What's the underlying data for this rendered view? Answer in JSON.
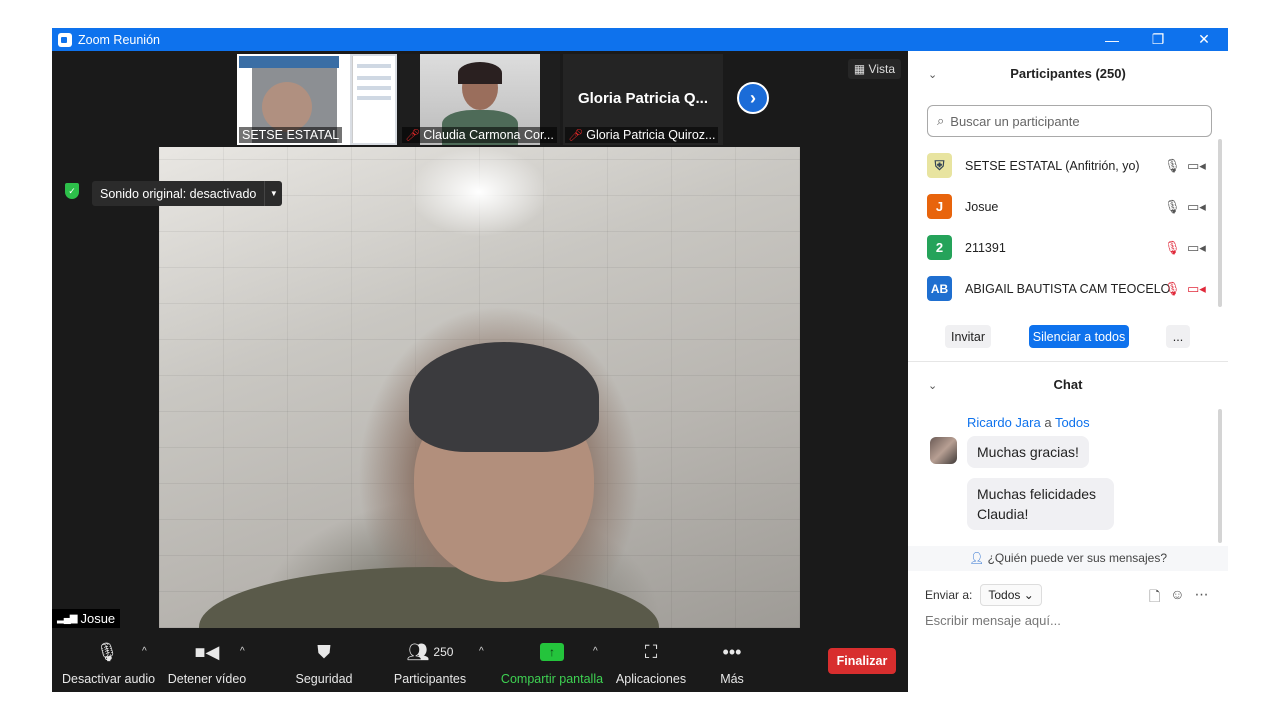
{
  "window": {
    "title": "Zoom Reunión",
    "controls": [
      "—",
      "❐",
      "✕"
    ]
  },
  "stage": {
    "view_label": "Vista",
    "thumbnails": [
      {
        "name": "SETSE ESTATAL",
        "muted": false
      },
      {
        "name": "Claudia Carmona Cor...",
        "muted": true
      },
      {
        "name": "Gloria Patricia Quiroz...",
        "muted": true,
        "big_name": "Gloria Patricia Q..."
      }
    ],
    "next_icon": "›",
    "sound_original": "Sonido original: desactivado",
    "active_speaker": "Josue"
  },
  "toolbar": {
    "audio": "Desactivar audio",
    "video": "Detener vídeo",
    "security": "Seguridad",
    "participants": "Participantes",
    "participants_count": "250",
    "share": "Compartir pantalla",
    "apps": "Aplicaciones",
    "more": "Más",
    "end": "Finalizar"
  },
  "participants_panel": {
    "title": "Participantes (250)",
    "search_placeholder": "Buscar un participante",
    "list": [
      {
        "initials": "",
        "name": "SETSE ESTATAL (Anfitrión, yo)",
        "color": "#e8e4a0",
        "mic_muted": false,
        "cam_off": false
      },
      {
        "initials": "J",
        "name": "Josue",
        "color": "#e8640c",
        "mic_muted": false,
        "cam_off": false
      },
      {
        "initials": "2",
        "name": "211391",
        "color": "#25a35a",
        "mic_muted": true,
        "cam_off": false
      },
      {
        "initials": "AB",
        "name": "ABIGAIL BAUTISTA CAM TEOCELO",
        "color": "#1f6fd0",
        "mic_muted": true,
        "cam_off": true
      }
    ],
    "invite": "Invitar",
    "mute_all": "Silenciar a todos",
    "more": "..."
  },
  "chat_panel": {
    "title": "Chat",
    "sender": "Ricardo Jara",
    "to_word": "a",
    "recipient": "Todos",
    "messages": [
      "Muchas gracias!",
      "Muchas felicidades Claudia!"
    ],
    "who_can_see": "¿Quién puede ver sus mensajes?",
    "send_to_label": "Enviar a:",
    "send_to_value": "Todos",
    "input_placeholder": "Escribir mensaje aquí..."
  },
  "colors": {
    "brand_blue": "#0e72ed",
    "end_red": "#d82e2e",
    "share_green": "#24c43c",
    "muted_red": "#e0293a"
  }
}
